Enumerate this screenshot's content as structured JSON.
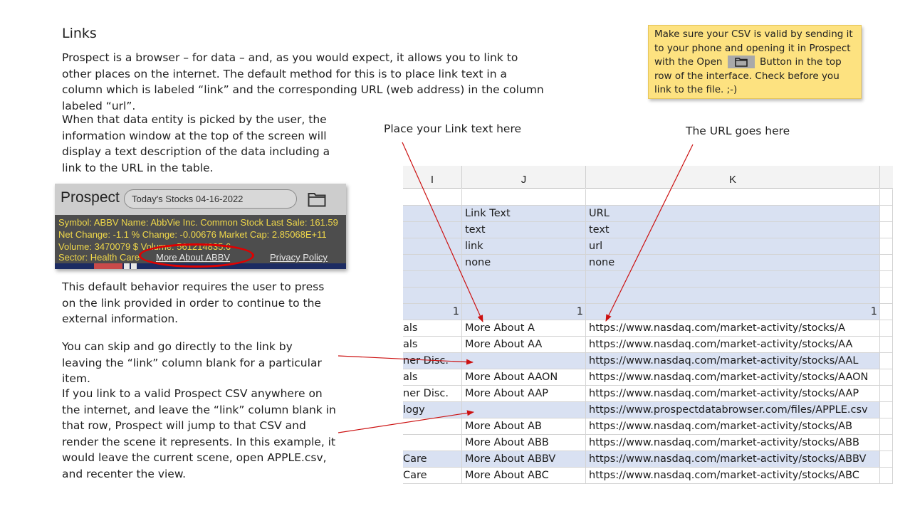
{
  "slide": {
    "title": "Links",
    "p1": "Prospect is a browser – for data – and, as you would expect, it allows you to link to other places on the internet. The default method for this is to place link text in a column which is labeled “link” and the corresponding URL (web address) in the column labeled “url”.",
    "p2": "When that data entity is picked by the user, the information window at the top of the screen will display a text description of the data including a link to the URL in the table.",
    "p3": "This default behavior requires the user to press on the link provided in order to continue to the external information.",
    "p4": "You can skip and go directly to the link by leaving the “link” column blank for a particular item.",
    "p5": "If you link to a valid Prospect CSV anywhere on the internet, and leave the “link” column blank in that row, Prospect will jump to that CSV and render the scene it represents.  In this example, it would leave the current scene, open APPLE.csv, and recenter the view."
  },
  "note": {
    "part1": "Make sure your CSV is valid by sending it to your phone and opening it in Prospect with the Open",
    "part2": "Button in the top row of the interface. Check before you link to the file.   ;-)",
    "icon": "folder-icon",
    "color": "#fde280"
  },
  "widget": {
    "app_name": "Prospect",
    "search_value": "Today's Stocks 04-16-2022",
    "info": "Symbol: ABBV   Name: AbbVie Inc. Common Stock   Last Sale: 161.59   Net Change: -1.1   % Change: -0.00676   Market Cap: 2.85068E+11   Volume: 3470079   $ Volume: 561214835.6",
    "sector": "Sector: Health Care",
    "link": "More About ABBV",
    "privacy": "Privacy Policy",
    "icon": "folder-icon",
    "info_color": "#f0d84a",
    "highlight_color": "#e00000"
  },
  "labels": {
    "link_text": "Place your Link text here",
    "url_text": "The URL goes here",
    "arrow_color": "#cc1111"
  },
  "sheet": {
    "col_headers": [
      "I",
      "J",
      "K"
    ],
    "rows": [
      {
        "i": "",
        "j": "",
        "k": "",
        "blue": false
      },
      {
        "i": "",
        "j": "Link Text",
        "k": "URL",
        "blue": true
      },
      {
        "i": "",
        "j": "text",
        "k": "text",
        "blue": true
      },
      {
        "i": "",
        "j": "link",
        "k": "url",
        "blue": true
      },
      {
        "i": "",
        "j": "none",
        "k": "none",
        "blue": true
      },
      {
        "i": "",
        "j": "",
        "k": "",
        "blue": true
      },
      {
        "i": "",
        "j": "",
        "k": "",
        "blue": true
      },
      {
        "i": "1",
        "j": "1",
        "k": "1",
        "blue": true,
        "numeric": true
      },
      {
        "i": "als",
        "j": "More About A",
        "k": "https://www.nasdaq.com/market-activity/stocks/A",
        "blue": false
      },
      {
        "i": "als",
        "j": "More About AA",
        "k": "https://www.nasdaq.com/market-activity/stocks/AA",
        "blue": false
      },
      {
        "i": "ner Disc.",
        "j": "",
        "k": "https://www.nasdaq.com/market-activity/stocks/AAL",
        "blue": true
      },
      {
        "i": "als",
        "j": "More About AAON",
        "k": "https://www.nasdaq.com/market-activity/stocks/AAON",
        "blue": false
      },
      {
        "i": "ner Disc.",
        "j": "More About AAP",
        "k": "https://www.nasdaq.com/market-activity/stocks/AAP",
        "blue": false
      },
      {
        "i": "logy",
        "j": "",
        "k": "https://www.prospectdatabrowser.com/files/APPLE.csv",
        "blue": true
      },
      {
        "i": "",
        "j": "More About AB",
        "k": "https://www.nasdaq.com/market-activity/stocks/AB",
        "blue": false
      },
      {
        "i": "",
        "j": "More About ABB",
        "k": "https://www.nasdaq.com/market-activity/stocks/ABB",
        "blue": false
      },
      {
        "i": "Care",
        "j": "More About ABBV",
        "k": "https://www.nasdaq.com/market-activity/stocks/ABBV",
        "blue": true
      },
      {
        "i": "Care",
        "j": "More About ABC",
        "k": "https://www.nasdaq.com/market-activity/stocks/ABC",
        "blue": false
      }
    ]
  }
}
